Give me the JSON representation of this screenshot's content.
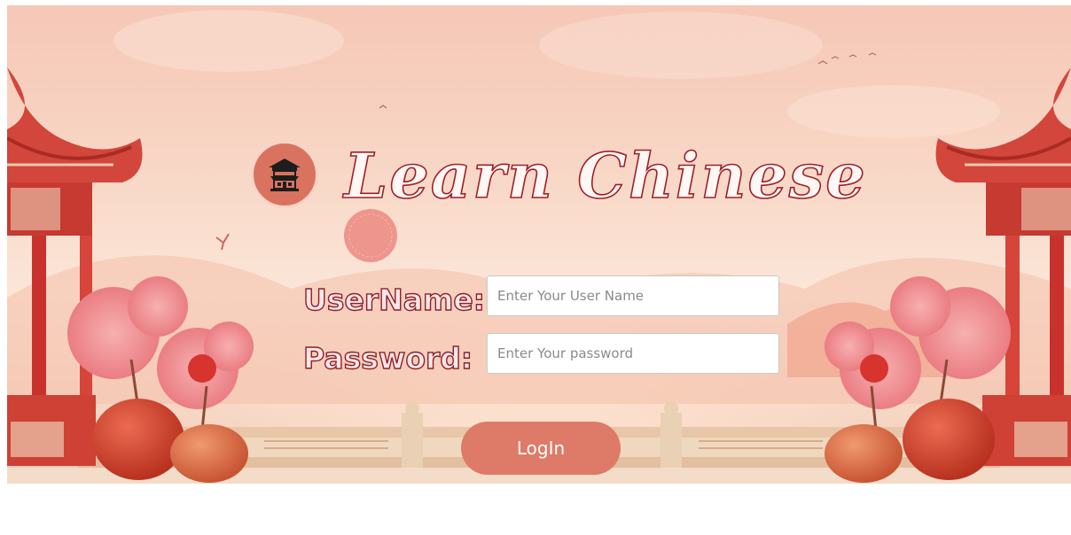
{
  "app": {
    "title": "Learn Chinese"
  },
  "logo": {
    "icon": "pagoda-house-icon"
  },
  "form": {
    "username_label": "UserName:",
    "username_placeholder": "Enter Your User Name",
    "username_value": "",
    "password_label": "Password:",
    "password_placeholder": "Enter Your password",
    "password_value": "",
    "login_label": "LogIn"
  },
  "colors": {
    "accent": "#de7a68",
    "title_outline": "#9e1f2a",
    "background": "#f8d7c6"
  }
}
